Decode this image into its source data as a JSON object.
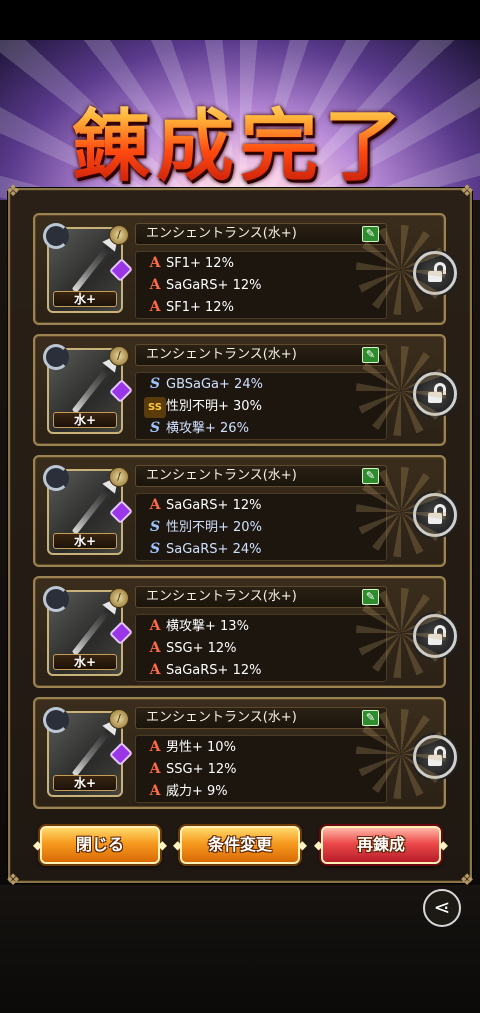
{
  "screen": {
    "title": "錬成完了"
  },
  "weapons": [
    {
      "name": "エンシェントランス(水+)",
      "tag": "水+",
      "stats": [
        {
          "icon": "A",
          "icon_type": "a",
          "text": "SF1+ 12%"
        },
        {
          "icon": "A",
          "icon_type": "a",
          "text": "SaGaRS+ 12%"
        },
        {
          "icon": "A",
          "icon_type": "a",
          "text": "SF1+ 12%"
        }
      ]
    },
    {
      "name": "エンシェントランス(水+)",
      "tag": "水+",
      "stats": [
        {
          "icon": "S",
          "icon_type": "s",
          "text": "GBSaGa+ 24%"
        },
        {
          "icon": "SS",
          "icon_type": "ss",
          "text": "性別不明+ 30%"
        },
        {
          "icon": "S",
          "icon_type": "s",
          "text": "横攻撃+ 26%"
        }
      ]
    },
    {
      "name": "エンシェントランス(水+)",
      "tag": "水+",
      "stats": [
        {
          "icon": "A",
          "icon_type": "a",
          "text": "SaGaRS+ 12%"
        },
        {
          "icon": "S",
          "icon_type": "s",
          "text": "性別不明+ 20%"
        },
        {
          "icon": "S",
          "icon_type": "s",
          "text": "SaGaRS+ 24%"
        }
      ]
    },
    {
      "name": "エンシェントランス(水+)",
      "tag": "水+",
      "stats": [
        {
          "icon": "A",
          "icon_type": "a",
          "text": "横攻撃+ 13%"
        },
        {
          "icon": "A",
          "icon_type": "a",
          "text": "SSG+ 12%"
        },
        {
          "icon": "A",
          "icon_type": "a",
          "text": "SaGaRS+ 12%"
        }
      ]
    },
    {
      "name": "エンシェントランス(水+)",
      "tag": "水+",
      "stats": [
        {
          "icon": "A",
          "icon_type": "a",
          "text": "男性+ 10%"
        },
        {
          "icon": "A",
          "icon_type": "a",
          "text": "SSG+ 12%"
        },
        {
          "icon": "A",
          "icon_type": "a",
          "text": "威力+ 9%"
        }
      ]
    }
  ],
  "buttons": {
    "close_label": "閉じる",
    "change_conditions_label": "条件変更",
    "reforge_label": "再錬成"
  },
  "colors": {
    "title_orange": "#ff5a14",
    "button_orange": "#f79a1f",
    "button_red": "#ec4a4a",
    "rank_a": "#ff6b45",
    "rank_s": "#9ec4ff"
  }
}
